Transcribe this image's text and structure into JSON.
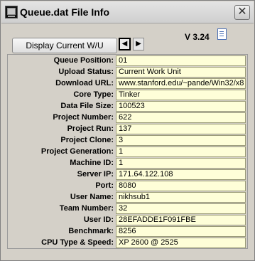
{
  "window": {
    "title": "Queue.dat File Info",
    "close_label": "✕"
  },
  "toolbar": {
    "display_button_label": "Display Current W/U",
    "prev_label": "◀",
    "next_label": "▶",
    "version": "V 3.24"
  },
  "fields": [
    {
      "label": "Queue Position:",
      "value": "01"
    },
    {
      "label": "Upload Status:",
      "value": "Current Work Unit"
    },
    {
      "label": "Download URL:",
      "value": "www.stanford.edu/~pande/Win32/x8"
    },
    {
      "label": "Core Type:",
      "value": "Tinker"
    },
    {
      "label": "Data File Size:",
      "value": "100523"
    },
    {
      "label": "Project Number:",
      "value": "622"
    },
    {
      "label": "Project Run:",
      "value": "137"
    },
    {
      "label": "Project Clone:",
      "value": "3"
    },
    {
      "label": "Project Generation:",
      "value": "1"
    },
    {
      "label": "Machine ID:",
      "value": "1"
    },
    {
      "label": "Server IP:",
      "value": "171.64.122.108"
    },
    {
      "label": "Port:",
      "value": "8080"
    },
    {
      "label": "User Name:",
      "value": "nikhsub1"
    },
    {
      "label": "Team Number:",
      "value": "32"
    },
    {
      "label": "User ID:",
      "value": "28EFADDE1F091FBE"
    },
    {
      "label": "Benchmark:",
      "value": "8256"
    },
    {
      "label": "CPU Type & Speed:",
      "value": "XP 2600 @ 2525"
    }
  ]
}
